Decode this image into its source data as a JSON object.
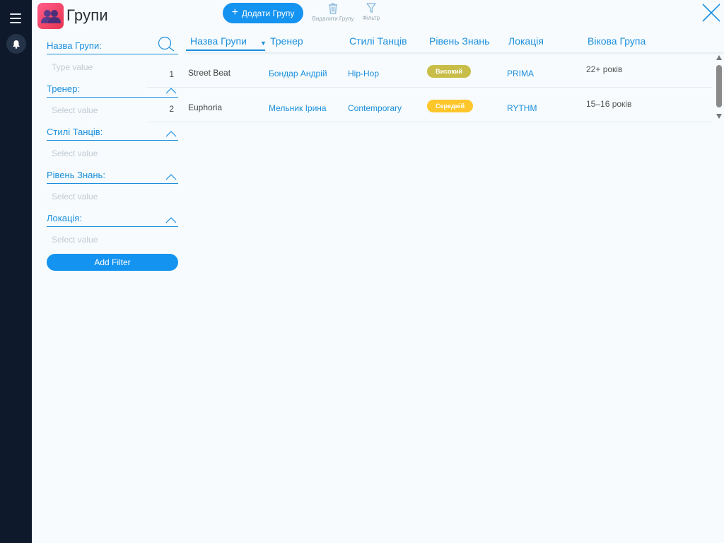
{
  "window": {
    "title": "Групи",
    "app_icon": "groups-icon",
    "accent_color": "#1493f0"
  },
  "toolbar": {
    "add_label": "Додати Групу",
    "delete_label": "Видалити Групу",
    "filter_label": "Фільтр"
  },
  "filters": {
    "items": [
      {
        "label": "Назва Групи:",
        "placeholder": "Type value",
        "icon": "search-icon"
      },
      {
        "label": "Тренер:",
        "placeholder": "Select value",
        "icon": "chevron-up-icon"
      },
      {
        "label": "Стилі Танців:",
        "placeholder": "Select value",
        "icon": "chevron-up-icon"
      },
      {
        "label": "Рівень Знань:",
        "placeholder": "Select value",
        "icon": "chevron-up-icon"
      },
      {
        "label": "Локація:",
        "placeholder": "Select value",
        "icon": "chevron-up-icon"
      }
    ],
    "add_filter_label": "Add Filter"
  },
  "table": {
    "columns": [
      "Назва Групи",
      "Тренер",
      "Стилі Танців",
      "Рівень Знань",
      "Локація",
      "Вікова Група"
    ],
    "sorted_column": "Назва Групи",
    "sort_indicator": "▼",
    "rows": [
      {
        "num": "1",
        "name": "Street Beat",
        "trainer": "Бондар Андрій",
        "style": "Hip-Hop",
        "level": "Високий",
        "level_color": "#c8bd48",
        "location": "PRIMA",
        "age": "22+ років"
      },
      {
        "num": "2",
        "name": "Euphoria",
        "trainer": "Мельник Ірина",
        "style": "Contemporary",
        "level": "Середній",
        "level_color": "#fdc62a",
        "location": "RYTHM",
        "age": "15–16 років"
      }
    ]
  }
}
